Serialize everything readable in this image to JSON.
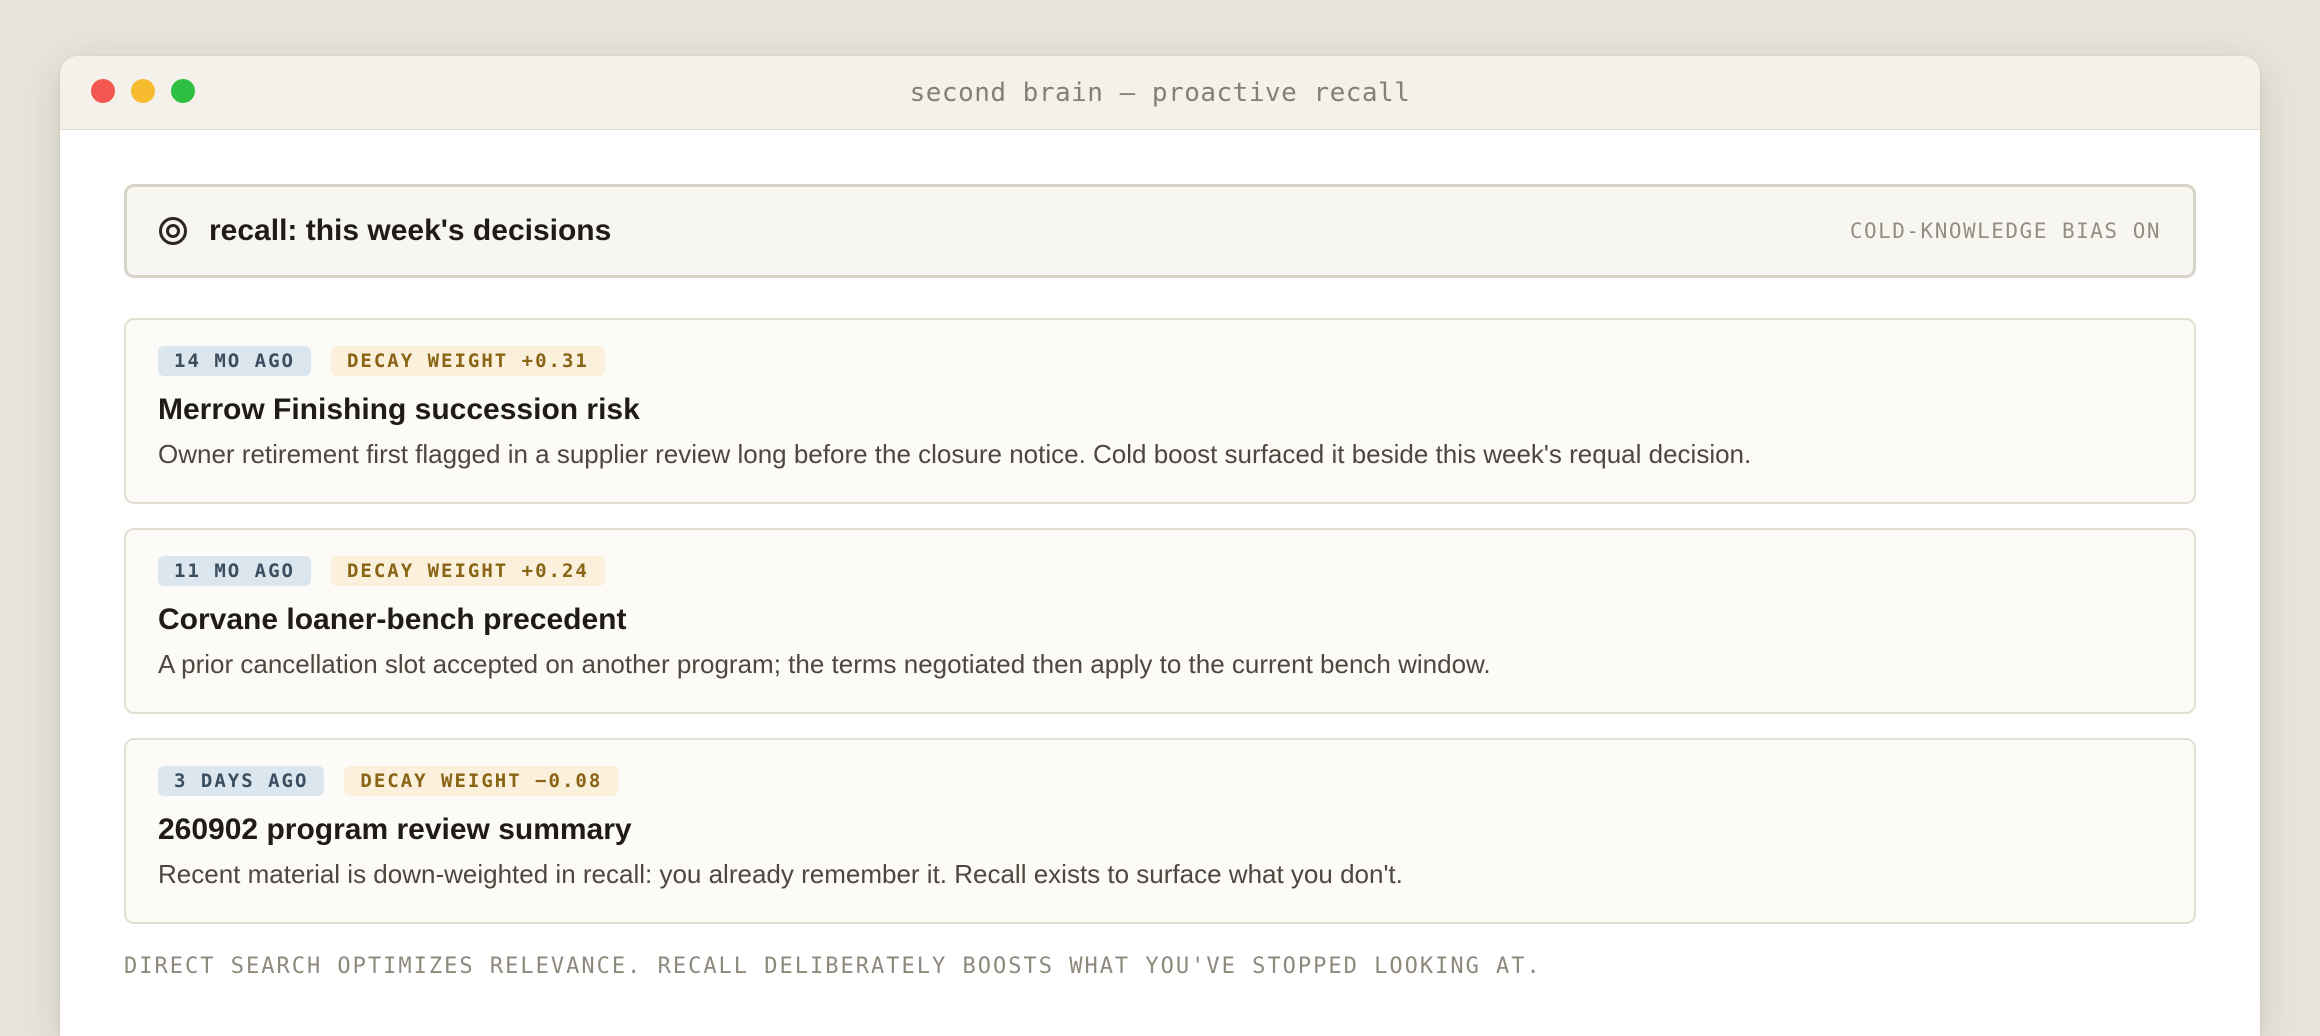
{
  "window": {
    "title": "second brain — proactive recall"
  },
  "query": {
    "icon": "target-icon",
    "text": "recall: this week's decisions",
    "flag": "COLD-KNOWLEDGE BIAS ON"
  },
  "cards": [
    {
      "age": "14 MO AGO",
      "decay": "DECAY WEIGHT +0.31",
      "title": "Merrow Finishing succession risk",
      "body": "Owner retirement first flagged in a supplier review long before the closure notice. Cold boost surfaced it beside this week's requal decision."
    },
    {
      "age": "11 MO AGO",
      "decay": "DECAY WEIGHT +0.24",
      "title": "Corvane loaner-bench precedent",
      "body": "A prior cancellation slot accepted on another program; the terms negotiated then apply to the current bench window."
    },
    {
      "age": "3 DAYS AGO",
      "decay": "DECAY WEIGHT −0.08",
      "title": "260902 program review summary",
      "body": "Recent material is down-weighted in recall: you already remember it. Recall exists to surface what you don't."
    }
  ],
  "footer": "DIRECT SEARCH OPTIMIZES RELEVANCE. RECALL DELIBERATELY BOOSTS WHAT YOU'VE STOPPED LOOKING AT.",
  "colors": {
    "close": "#f2584f",
    "minimize": "#f6bb2e",
    "maximize": "#2fc043",
    "age_tag_bg": "#dbe6ee",
    "decay_tag_bg": "#faf0dc"
  }
}
